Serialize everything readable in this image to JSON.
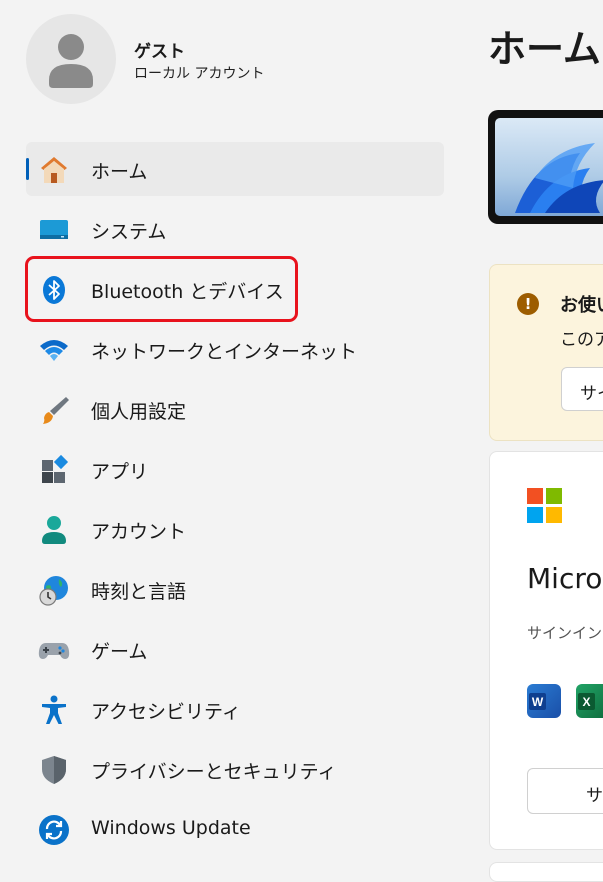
{
  "profile": {
    "name": "ゲスト",
    "account_type": "ローカル アカウント",
    "avatar_icon": "person-icon"
  },
  "nav": {
    "items": [
      {
        "label": "ホーム",
        "icon": "home-icon",
        "selected": true
      },
      {
        "label": "システム",
        "icon": "monitor-icon"
      },
      {
        "label": "Bluetooth とデバイス",
        "icon": "bluetooth-icon",
        "highlighted": true
      },
      {
        "label": "ネットワークとインターネット",
        "icon": "wifi-icon"
      },
      {
        "label": "個人用設定",
        "icon": "brush-icon"
      },
      {
        "label": "アプリ",
        "icon": "apps-icon"
      },
      {
        "label": "アカウント",
        "icon": "account-icon"
      },
      {
        "label": "時刻と言語",
        "icon": "globe-clock-icon"
      },
      {
        "label": "ゲーム",
        "icon": "gamepad-icon"
      },
      {
        "label": "アクセシビリティ",
        "icon": "accessibility-icon"
      },
      {
        "label": "プライバシーとセキュリティ",
        "icon": "shield-icon"
      },
      {
        "label": "Windows Update",
        "icon": "update-icon"
      }
    ]
  },
  "main": {
    "title": "ホーム",
    "notice": {
      "title": "お使い",
      "description": "このア",
      "button_label": "サイ"
    },
    "microsoft_card": {
      "title": "Micro",
      "description": "サインイン",
      "apps": [
        "word-icon",
        "excel-icon"
      ],
      "button_label": "サ"
    }
  },
  "colors": {
    "accent": "#005fb8",
    "highlight_box": "#e8121c",
    "notice_background": "#fcf4dd",
    "notice_icon": "#9d5d00"
  }
}
